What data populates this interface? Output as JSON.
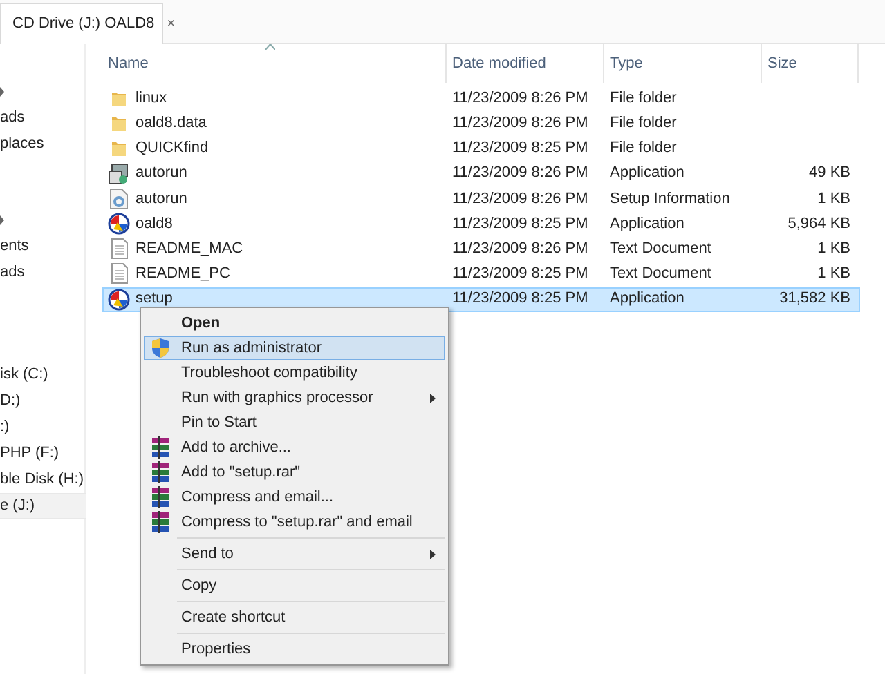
{
  "tab": {
    "title": "CD Drive (J:) OALD8",
    "close": "×"
  },
  "sidebar": {
    "groups": [
      {
        "header": true,
        "items": [
          {
            "label": "ads",
            "selected": false
          },
          {
            "label": "places",
            "selected": false
          }
        ]
      },
      {
        "header": true,
        "items": [
          {
            "label": "ents",
            "selected": false
          },
          {
            "label": "ads",
            "selected": false
          }
        ]
      },
      {
        "header": false,
        "items": [
          {
            "label": "isk (C:)",
            "selected": false
          },
          {
            "label": "D:)",
            "selected": false
          },
          {
            "label": ":)",
            "selected": false
          },
          {
            "label": "PHP (F:)",
            "selected": false
          },
          {
            "label": "ble Disk (H:)",
            "selected": false
          },
          {
            "label": "e (J:)",
            "selected": true
          }
        ]
      }
    ]
  },
  "table": {
    "columns": [
      "Name",
      "Date modified",
      "Type",
      "Size"
    ],
    "rows": [
      {
        "kind": "folder",
        "name": "linux",
        "date": "11/23/2009 8:26 PM",
        "type": "File folder",
        "selected": false
      },
      {
        "kind": "folder",
        "name": "oald8.data",
        "date": "11/23/2009 8:26 PM",
        "type": "File folder",
        "selected": false
      },
      {
        "kind": "folder",
        "name": "QUICKfind",
        "date": "11/23/2009 8:25 PM",
        "type": "File folder",
        "selected": false
      },
      {
        "kind": "program",
        "name": "autorun",
        "date": "11/23/2009 8:26 PM",
        "type": "Application",
        "size": "49 KB",
        "selected": false
      },
      {
        "kind": "settings",
        "name": "autorun",
        "date": "11/23/2009 8:26 PM",
        "type": "Setup Information",
        "size": "1 KB",
        "selected": false
      },
      {
        "kind": "installer",
        "name": "oald8",
        "date": "11/23/2009 8:25 PM",
        "type": "Application",
        "size": "5,964 KB",
        "selected": false
      },
      {
        "kind": "text",
        "name": "README_MAC",
        "date": "11/23/2009 8:26 PM",
        "type": "Text Document",
        "size": "1 KB",
        "selected": false
      },
      {
        "kind": "text",
        "name": "README_PC",
        "date": "11/23/2009 8:25 PM",
        "type": "Text Document",
        "size": "1 KB",
        "selected": false
      },
      {
        "kind": "installer",
        "name": "setup",
        "date": "11/23/2009 8:25 PM",
        "type": "Application",
        "size": "31,582 KB",
        "selected": true
      }
    ]
  },
  "context_menu": {
    "groups": [
      [
        {
          "kind": "plain",
          "label": "Open",
          "default": true,
          "submenu": false,
          "selected": false
        },
        {
          "kind": "shield",
          "label": "Run as administrator",
          "default": false,
          "submenu": false,
          "selected": true
        },
        {
          "kind": "plain",
          "label": "Troubleshoot compatibility",
          "default": false,
          "submenu": false,
          "selected": false
        },
        {
          "kind": "plain",
          "label": "Run with graphics processor",
          "default": false,
          "submenu": true,
          "selected": false
        },
        {
          "kind": "plain",
          "label": "Pin to Start",
          "default": false,
          "submenu": false,
          "selected": false
        },
        {
          "kind": "archive",
          "label": "Add to archive...",
          "default": false,
          "submenu": false,
          "selected": false
        },
        {
          "kind": "archive",
          "label": "Add to \"setup.rar\"",
          "default": false,
          "submenu": false,
          "selected": false
        },
        {
          "kind": "archive",
          "label": "Compress and email...",
          "default": false,
          "submenu": false,
          "selected": false
        },
        {
          "kind": "archive",
          "label": "Compress to \"setup.rar\" and email",
          "default": false,
          "submenu": false,
          "selected": false
        }
      ],
      [
        {
          "kind": "plain",
          "label": "Send to",
          "default": false,
          "submenu": true,
          "selected": false
        }
      ],
      [
        {
          "kind": "plain",
          "label": "Copy",
          "default": false,
          "submenu": false,
          "selected": false
        }
      ],
      [
        {
          "kind": "plain",
          "label": "Create shortcut",
          "default": false,
          "submenu": false,
          "selected": false
        }
      ],
      [
        {
          "kind": "plain",
          "label": "Properties",
          "default": false,
          "submenu": false,
          "selected": false
        }
      ]
    ]
  }
}
